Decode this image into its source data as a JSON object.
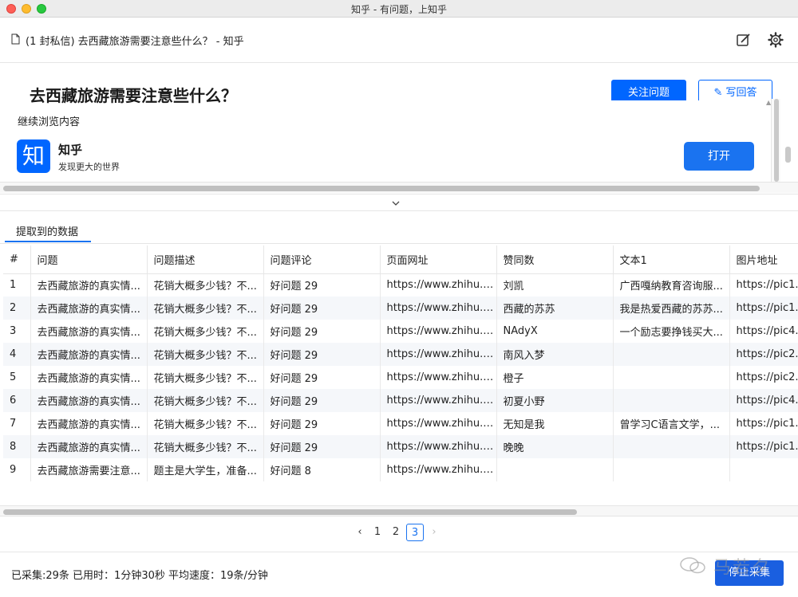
{
  "window": {
    "title": "知乎 - 有问题，上知乎"
  },
  "header": {
    "page_title": "(1 封私信) 去西藏旅游需要注意些什么？ - 知乎"
  },
  "web": {
    "question_title": "去西藏旅游需要注意些什么？",
    "follow_button": "关注问题",
    "answer_button": "写回答",
    "continue_text": "继续浏览内容",
    "logo_char": "知",
    "app_name": "知乎",
    "app_desc": "发现更大的世界",
    "open_button": "打开",
    "brand_color": "#0066ff"
  },
  "tab": {
    "label": "提取到的数据"
  },
  "table": {
    "columns": [
      "#",
      "问题",
      "问题描述",
      "问题评论",
      "页面网址",
      "赞同数",
      "文本1",
      "图片地址"
    ],
    "rows": [
      [
        "1",
        "去西藏旅游的真实情...",
        "花销大概多少钱？不...",
        "好问题 29",
        "https://www.zhihu.c...",
        "刘凯",
        "广西嘎纳教育咨询服...",
        "https://pic1..."
      ],
      [
        "2",
        "去西藏旅游的真实情...",
        "花销大概多少钱？不...",
        "好问题 29",
        "https://www.zhihu.c...",
        "西藏的苏苏",
        "我是热爱西藏的苏苏...",
        "https://pic1..."
      ],
      [
        "3",
        "去西藏旅游的真实情...",
        "花销大概多少钱？不...",
        "好问题 29",
        "https://www.zhihu.c...",
        "NAdyX",
        "一个励志要挣钱买大...",
        "https://pic4..."
      ],
      [
        "4",
        "去西藏旅游的真实情...",
        "花销大概多少钱？不...",
        "好问题 29",
        "https://www.zhihu.c...",
        "南风入梦",
        "",
        "https://pic2..."
      ],
      [
        "5",
        "去西藏旅游的真实情...",
        "花销大概多少钱？不...",
        "好问题 29",
        "https://www.zhihu.c...",
        "橙子",
        "",
        "https://pic2..."
      ],
      [
        "6",
        "去西藏旅游的真实情...",
        "花销大概多少钱？不...",
        "好问题 29",
        "https://www.zhihu.c...",
        "初夏小野",
        "",
        "https://pic4..."
      ],
      [
        "7",
        "去西藏旅游的真实情...",
        "花销大概多少钱？不...",
        "好问题 29",
        "https://www.zhihu.c...",
        "无知是我",
        "曾学习C语言文学，...",
        "https://pic1..."
      ],
      [
        "8",
        "去西藏旅游的真实情...",
        "花销大概多少钱？不...",
        "好问题 29",
        "https://www.zhihu.c...",
        "晚晚",
        "",
        "https://pic1..."
      ],
      [
        "9",
        "去西藏旅游需要注意...",
        "题主是大学生，准备...",
        "好问题 8",
        "https://www.zhihu.c...",
        "",
        "",
        ""
      ]
    ]
  },
  "pagination": {
    "prev": "‹",
    "pages": [
      "1",
      "2",
      "3"
    ],
    "current": "3",
    "next": "›"
  },
  "status": {
    "text": "已采集:29条 已用时：1分钟30秒 平均速度：19条/分钟",
    "stop_button": "停止采集",
    "watermark": "马若夕"
  }
}
